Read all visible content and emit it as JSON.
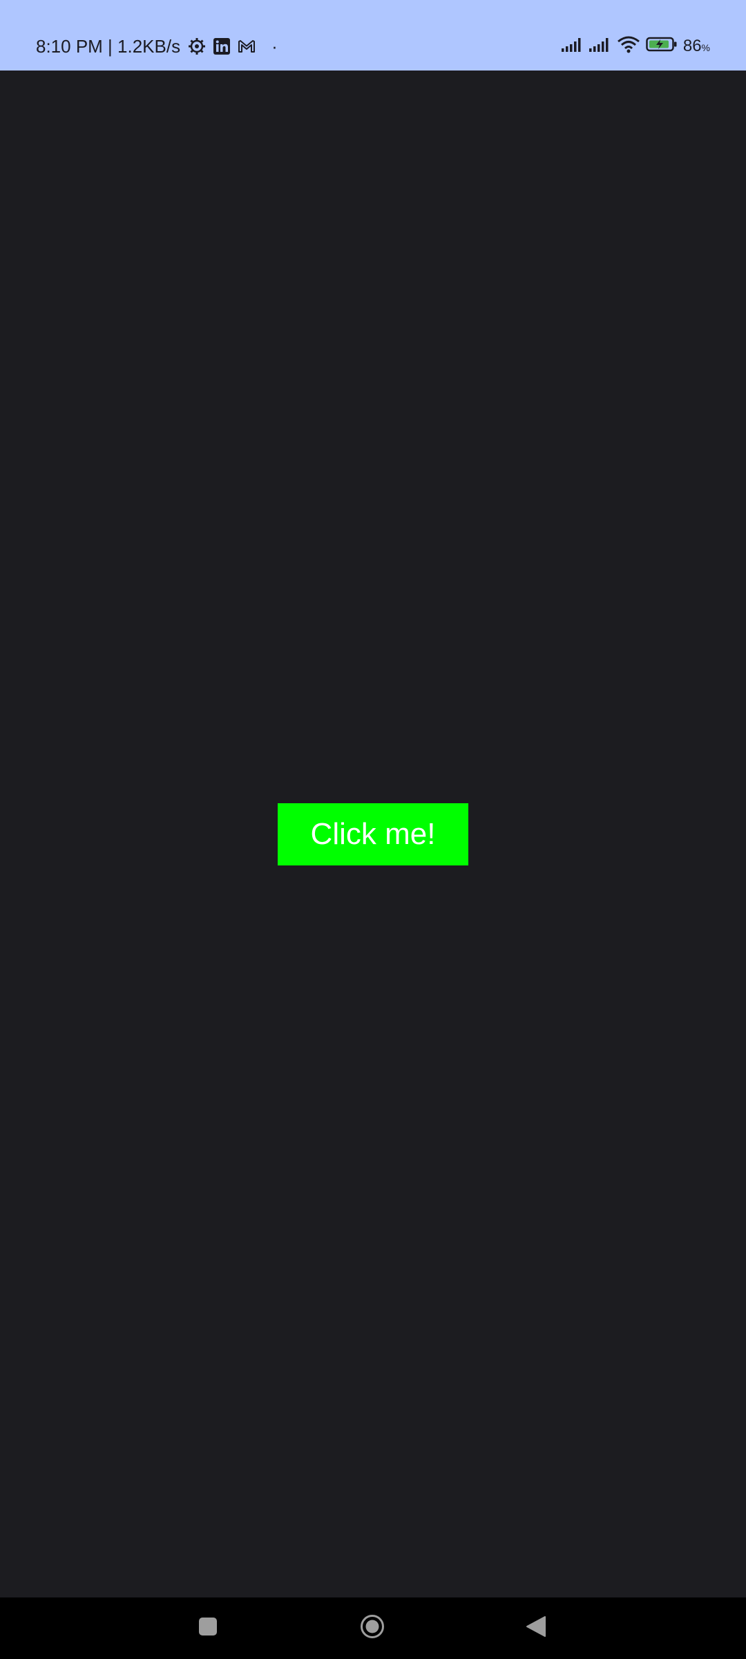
{
  "status_bar": {
    "time_speed": "8:10 PM | 1.2KB/s",
    "dot": "·",
    "left_icons": [
      "settings-gear-icon",
      "linkedin-icon",
      "gmail-icon"
    ],
    "right_icons": [
      "cellular-signal-icon",
      "cellular-signal-icon",
      "wifi-icon",
      "battery-charging-icon"
    ],
    "battery_percent": "86",
    "battery_unit": "%",
    "background_color": "#afc6ff"
  },
  "main": {
    "background_color": "#1c1c20",
    "button": {
      "label": "Click me!",
      "background_color": "#00ff00",
      "text_color": "#ffffff"
    }
  },
  "nav_bar": {
    "buttons": [
      "recents",
      "home",
      "back"
    ],
    "background_color": "#000000"
  }
}
